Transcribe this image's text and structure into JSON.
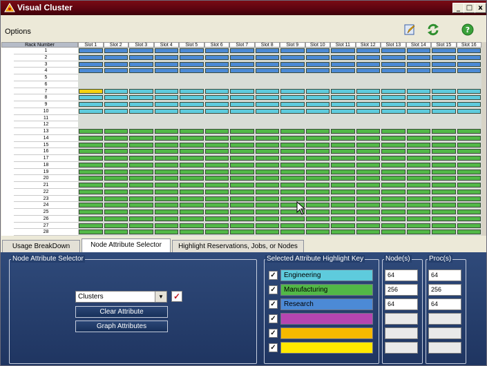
{
  "window": {
    "title": "Visual Cluster",
    "controls": [
      "_",
      "□",
      "x"
    ]
  },
  "menu": {
    "options_label": "Options"
  },
  "toolbar": {
    "icons": [
      "edit-icon",
      "refresh-icon",
      "help-icon"
    ]
  },
  "grid": {
    "rack_header": "Rack Number",
    "slots": [
      "Slot 1",
      "Slot 2",
      "Slot 3",
      "Slot 4",
      "Slot 5",
      "Slot 6",
      "Slot 7",
      "Slot 8",
      "Slot 9",
      "Slot 10",
      "Slot 11",
      "Slot 12",
      "Slot 13",
      "Slot 14",
      "Slot 15",
      "Slot 16"
    ],
    "racks": [
      "1",
      "2",
      "3",
      "4",
      "5",
      "6",
      "7",
      "8",
      "9",
      "10",
      "11",
      "12",
      "13",
      "14",
      "15",
      "16",
      "17",
      "18",
      "19",
      "20",
      "21",
      "22",
      "23",
      "24",
      "25",
      "26",
      "27",
      "28"
    ],
    "rack_fill": [
      "research",
      "research",
      "research",
      "research",
      "empty",
      "empty",
      "engineering",
      "engineering",
      "engineering",
      "engineering",
      "empty",
      "empty",
      "manufacturing",
      "manufacturing",
      "manufacturing",
      "manufacturing",
      "manufacturing",
      "manufacturing",
      "manufacturing",
      "manufacturing",
      "manufacturing",
      "manufacturing",
      "manufacturing",
      "manufacturing",
      "manufacturing",
      "manufacturing",
      "manufacturing",
      "manufacturing"
    ],
    "highlighted_cell": {
      "rack": "7",
      "slot": "Slot 1",
      "color": "#f5d20f"
    }
  },
  "colors": {
    "research": "#4c8ad6",
    "engineering": "#5ecbdd",
    "manufacturing": "#52b847",
    "empty": "#d8dcd6",
    "magenta": "#b545b0",
    "orange": "#f6b900",
    "yellow": "#ffe800"
  },
  "tabs": [
    {
      "label": "Usage BreakDown",
      "active": false
    },
    {
      "label": "Node Attribute Selector",
      "active": true
    },
    {
      "label": "Highlight Reservations, Jobs, or Nodes",
      "active": false
    }
  ],
  "attribute_selector": {
    "group_label": "Node Attribute Selector",
    "combo_value": "Clusters",
    "clear_button": "Clear Attribute",
    "graph_button": "Graph Attributes"
  },
  "key": {
    "group_label": "Selected Attribute Highlight Key",
    "nodes_label": "Node(s)",
    "procs_label": "Proc(s)",
    "rows": [
      {
        "label": "Engineering",
        "color": "#5ecbdd",
        "nodes": "64",
        "procs": "64"
      },
      {
        "label": "Manufacturing",
        "color": "#52b847",
        "nodes": "256",
        "procs": "256"
      },
      {
        "label": "Research",
        "color": "#4c8ad6",
        "nodes": "64",
        "procs": "64"
      },
      {
        "label": "",
        "color": "#b545b0",
        "nodes": "",
        "procs": ""
      },
      {
        "label": "",
        "color": "#f6b900",
        "nodes": "",
        "procs": ""
      },
      {
        "label": "",
        "color": "#ffe800",
        "nodes": "",
        "procs": ""
      }
    ]
  }
}
